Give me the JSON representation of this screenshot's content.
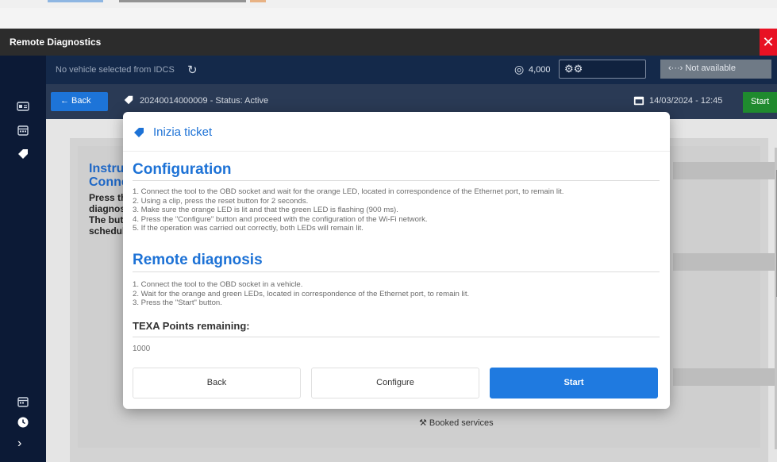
{
  "window": {
    "title": "Remote Diagnostics",
    "close_glyph": "✕"
  },
  "topbar": {
    "vehicle_status": "No vehicle selected from IDCS",
    "points": "4,000",
    "tool_glyph": "⚙⚙",
    "connection": "‹···› Not available"
  },
  "toolbar": {
    "back_label": "←  Back",
    "ticket_info": "20240014000009  -  Status: Active",
    "datetime": "14/03/2024 - 12:45",
    "start_label": "Start"
  },
  "background": {
    "heading_line1": "Instruct",
    "heading_line2": "Connect",
    "text_line1": "Press the '",
    "text_line2": "diagnosis.",
    "text_line3": "The button",
    "text_line4": "scheduled",
    "booked_services": "Booked services"
  },
  "modal": {
    "title": "Inizia ticket",
    "configuration": {
      "heading": "Configuration",
      "steps": [
        "1. Connect the tool to the OBD socket and wait for the orange LED, located in correspondence of the Ethernet port, to remain lit.",
        "2. Using a clip, press the reset button for 2 seconds.",
        "3. Make sure the orange LED is lit and that the green LED is flashing (900 ms).",
        "4. Press the \"Configure\" button and proceed with the configuration of the Wi-Fi network.",
        "5. If the operation was carried out correctly, both LEDs will remain lit."
      ]
    },
    "remote": {
      "heading": "Remote diagnosis",
      "steps": [
        "1. Connect the tool to the OBD socket in a vehicle.",
        "2. Wait for the orange and green LEDs, located in correspondence of the Ethernet port, to remain lit.",
        "3. Press the \"Start\" button."
      ]
    },
    "points_label": "TEXA Points remaining:",
    "points_value": "1000",
    "buttons": {
      "back": "Back",
      "configure": "Configure",
      "start": "Start"
    }
  },
  "colors": {
    "accent": "#1d72d6",
    "sidebar": "#0c1a36",
    "start_green": "#1f8a2e",
    "close_red": "#e81123"
  }
}
